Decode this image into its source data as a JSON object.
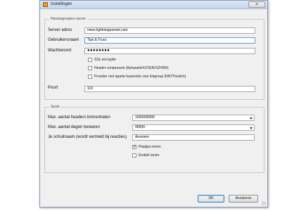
{
  "window": {
    "title": "Instellingen",
    "close_glyph": "×"
  },
  "newsgroup_group": {
    "legend": "Nieuwsgroepen server",
    "server_label": "Server adres",
    "server_value": "news.lightningusenet.com",
    "username_label": "Gebruikersnaam",
    "username_value": "Tips & Trucs",
    "password_label": "Wachtwoord",
    "password_value": "●●●●●●●●",
    "ssl_label": "SSL encryptie",
    "ssl_checked": false,
    "header_label": "Header compressie (Astraweb/XZVER/XZHDR)",
    "header_checked": false,
    "provider_label": "Provider met aparte backends voor listgroup (NNTPswitch)",
    "provider_checked": false,
    "port_label": "Poort",
    "port_value": "119"
  },
  "spots_group": {
    "legend": "Spots",
    "max_headers_label": "Max. aantal headers binnenhalen",
    "max_headers_value": "1000000000",
    "max_days_label": "Max. aantal dagen bewaren",
    "max_days_value": "99999",
    "nickname_label": "Je schuilnaam (wordt vermeld bij reacties)",
    "nickname_value": "Anoniem",
    "images_label": "Plaatjes tonen",
    "images_checked": true,
    "erotic_label": "Erotiek tonen",
    "erotic_checked": false
  },
  "buttons": {
    "ok": "OK",
    "cancel": "Annuleren"
  },
  "icons": {
    "app": "app-icon",
    "close": "close-icon",
    "check": "check-icon",
    "dropdown": "chevron-down-icon"
  }
}
